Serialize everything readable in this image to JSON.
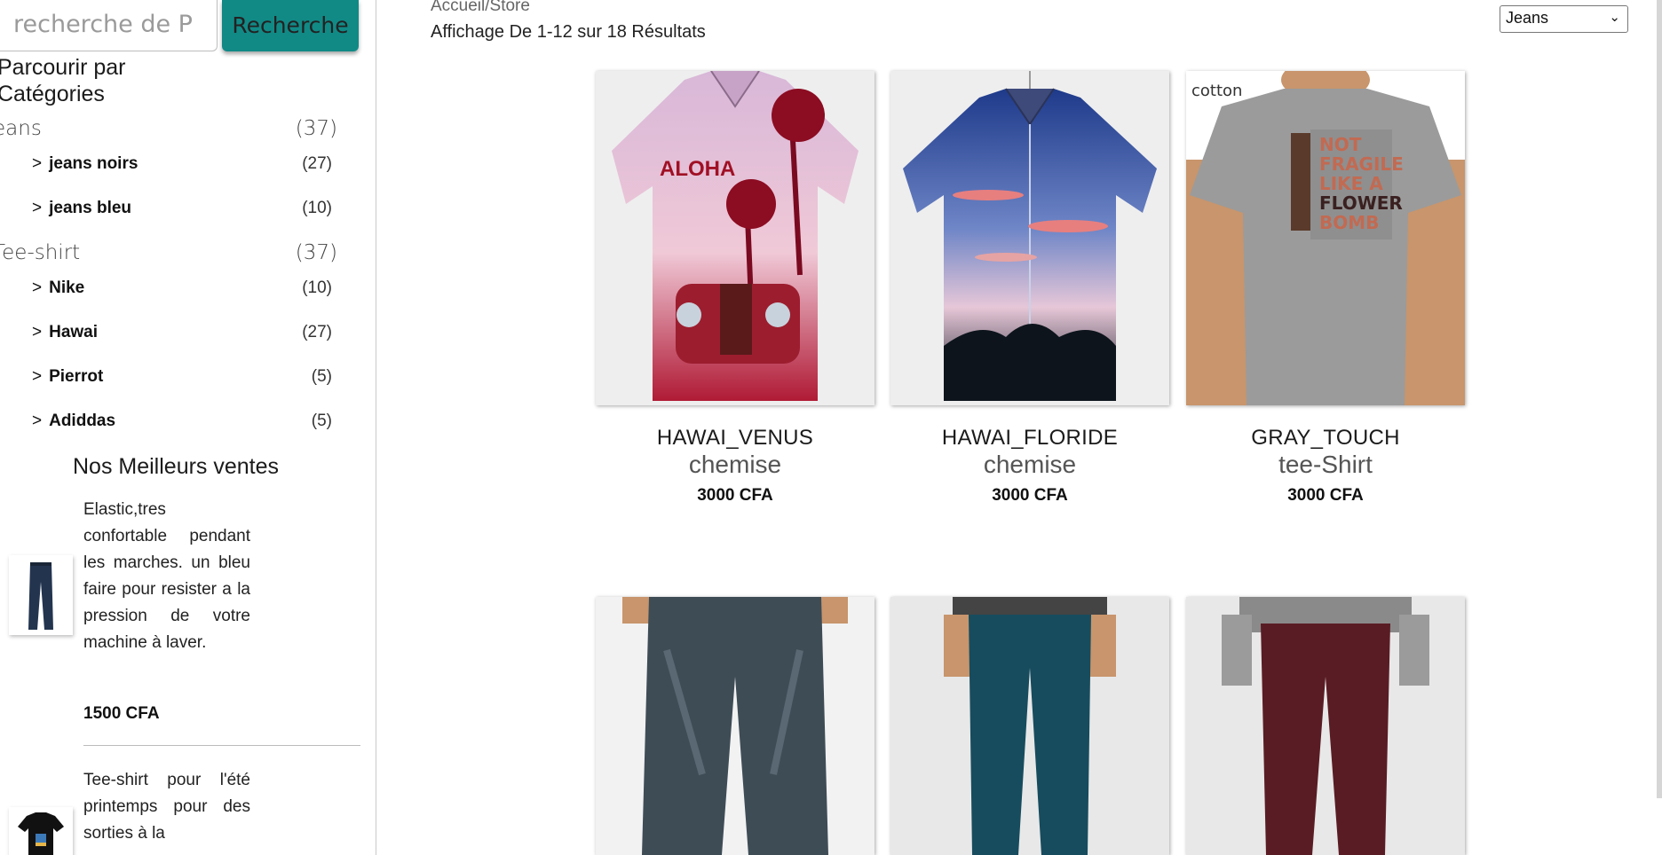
{
  "search": {
    "placeholder": "recherche de P",
    "button_label": "Recherche"
  },
  "sidebar": {
    "browse_title": "Parcourir par Catégories",
    "categories": [
      {
        "name": "eans",
        "count": "(37)",
        "subs": [
          {
            "name": "jeans noirs",
            "count": "(27)"
          },
          {
            "name": "jeans bleu",
            "count": "(10)"
          }
        ]
      },
      {
        "name": "Tee-shirt",
        "count": "(37)",
        "subs": [
          {
            "name": "Nike",
            "count": "(10)"
          },
          {
            "name": "Hawai",
            "count": "(27)"
          },
          {
            "name": "Pierrot",
            "count": "(5)"
          },
          {
            "name": "Adiddas",
            "count": "(5)"
          }
        ]
      }
    ],
    "arrow": ">"
  },
  "best_sellers": {
    "title": "Nos Meilleurs ventes",
    "items": [
      {
        "desc": "Elastic,tres confortable pendant les marches. un bleu faire pour resister a la pression de votre machine à laver.",
        "price": "1500 CFA",
        "thumb_icon": "jeans-thumbnail"
      },
      {
        "desc": "Tee-shirt pour l'été printemps pour des sorties à la",
        "price": "",
        "thumb_icon": "tshirt-thumbnail"
      }
    ]
  },
  "main": {
    "breadcrumb": "Accueil/Store",
    "results": "Affichage De 1-12 sur 18 Résultats",
    "sort_value": "Jeans"
  },
  "products": [
    {
      "name": "HAWAI_VENUS",
      "type": "chemise",
      "price": "3000 CFA",
      "image": "aloha-shirt-pink"
    },
    {
      "name": "HAWAI_FLORIDE",
      "type": "chemise",
      "price": "3000 CFA",
      "image": "sunset-shirt-blue"
    },
    {
      "name": "GRAY_TOUCH",
      "type": "tee-Shirt",
      "price": "3000 CFA",
      "image": "gray-tshirt-print"
    },
    {
      "name": "",
      "type": "",
      "price": "",
      "image": "distressed-blue-jeans"
    },
    {
      "name": "",
      "type": "",
      "price": "",
      "image": "teal-chinos"
    },
    {
      "name": "",
      "type": "",
      "price": "",
      "image": "burgundy-chinos"
    }
  ],
  "colors": {
    "accent": "#118a86",
    "border": "#c9c9c9"
  }
}
